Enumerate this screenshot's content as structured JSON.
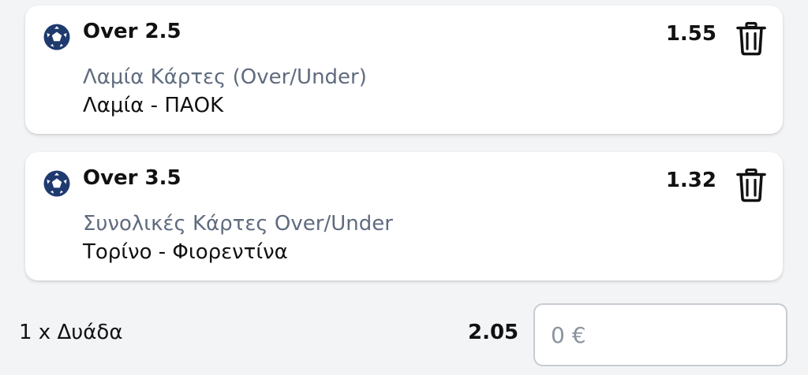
{
  "selections": [
    {
      "name": "Over 2.5",
      "odds": "1.55",
      "market": "Λαμία Κάρτες (Over/Under)",
      "match": "Λαμία - ΠΑΟΚ",
      "sport_icon": "soccer-ball-icon",
      "delete_icon": "trash-icon"
    },
    {
      "name": "Over 3.5",
      "odds": "1.32",
      "market": "Συνολικές Κάρτες Over/Under",
      "match": "Τορίνο - Φιορεντίνα",
      "sport_icon": "soccer-ball-icon",
      "delete_icon": "trash-icon"
    }
  ],
  "summary": {
    "bet_type": "1 x Δυάδα",
    "total_odds": "2.05",
    "stake_placeholder": "0 €"
  },
  "colors": {
    "ball": "#1f3a6e",
    "market_text": "#5f6b7e",
    "background": "#f3f4f6"
  }
}
